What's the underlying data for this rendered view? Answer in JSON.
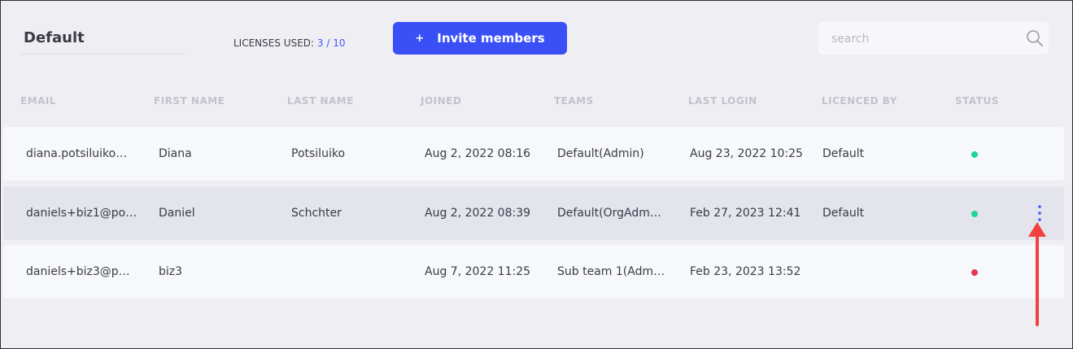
{
  "workspace": {
    "title": "Default"
  },
  "licenses": {
    "label": "LICENSES USED:",
    "count": "3 / 10"
  },
  "invite": {
    "plus": "+",
    "label": "Invite members"
  },
  "search": {
    "placeholder": "search"
  },
  "table": {
    "headers": [
      "EMAIL",
      "FIRST NAME",
      "LAST NAME",
      "JOINED",
      "TEAMS",
      "LAST LOGIN",
      "LICENCED BY",
      "STATUS"
    ],
    "rows": [
      {
        "email": "diana.potsiluiko…",
        "first_name": "Diana",
        "last_name": "Potsiluiko",
        "joined": "Aug 2, 2022 08:16",
        "teams": "Default(Admin)",
        "last_login": "Aug 23, 2022 10:25",
        "licensed_by": "Default",
        "status": "active",
        "status_color": "#1ed796"
      },
      {
        "email": "daniels+biz1@po…",
        "first_name": "Daniel",
        "last_name": "Schchter",
        "joined": "Aug 2, 2022 08:39",
        "teams": "Default(OrgAdm…",
        "last_login": "Feb 27, 2023 12:41",
        "licensed_by": "Default",
        "status": "active",
        "status_color": "#1ed796"
      },
      {
        "email": "daniels+biz3@p…",
        "first_name": "biz3",
        "last_name": "",
        "joined": "Aug 7, 2022 11:25",
        "teams": "Sub team 1(Adm…",
        "last_login": "Feb 23, 2023 13:52",
        "licensed_by": "",
        "status": "inactive",
        "status_color": "#e53950"
      }
    ]
  },
  "colors": {
    "accent": "#3a50f6",
    "kebab": "#3d5afe",
    "annotation_arrow": "#f0413f"
  }
}
